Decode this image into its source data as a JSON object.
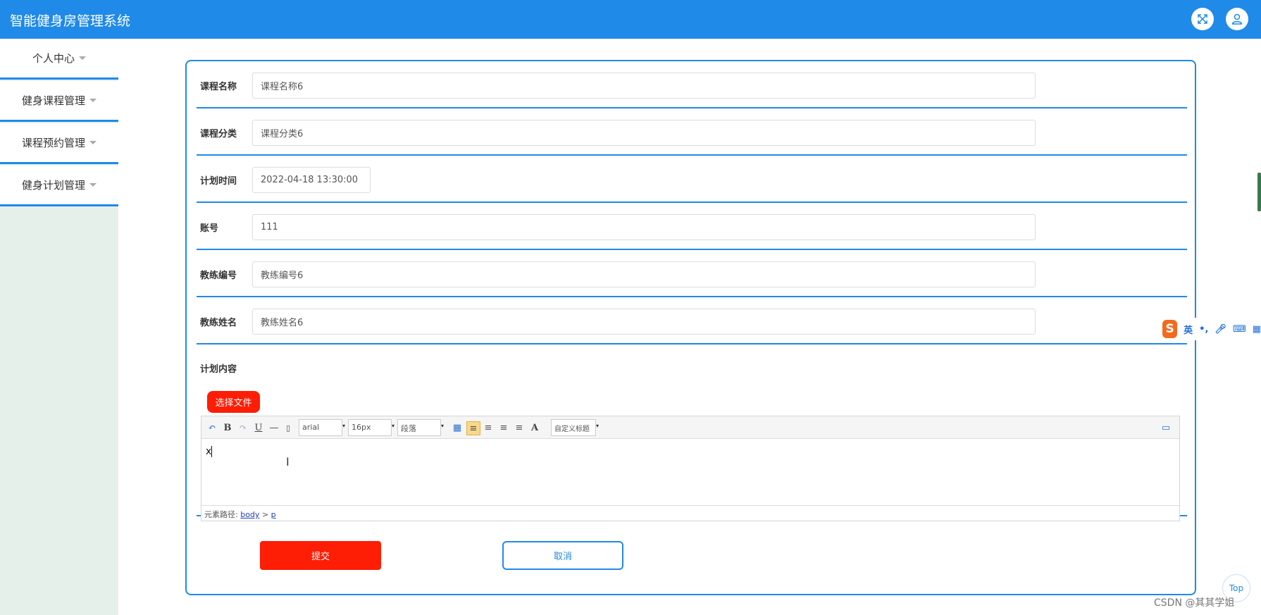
{
  "header": {
    "title": "智能健身房管理系统",
    "fullscreen_icon": "fullscreen-icon",
    "user_icon": "user-icon"
  },
  "sidebar": {
    "items": [
      {
        "label": "个人中心"
      },
      {
        "label": "健身课程管理"
      },
      {
        "label": "课程预约管理"
      },
      {
        "label": "健身计划管理"
      }
    ]
  },
  "form": {
    "fields": [
      {
        "label": "课程名称",
        "value": "课程名称6"
      },
      {
        "label": "课程分类",
        "value": "课程分类6"
      },
      {
        "label": "计划时间",
        "value": "2022-04-18 13:30:00"
      },
      {
        "label": "账号",
        "value": "111"
      },
      {
        "label": "教练编号",
        "value": "教练编号6"
      },
      {
        "label": "教练姓名",
        "value": "教练姓名6"
      }
    ],
    "content_label": "计划内容",
    "choose_file": "选择文件",
    "editor": {
      "font_family": "arial",
      "font_size": "16px",
      "paragraph": "段落",
      "custom_heading": "自定义标题",
      "text": "x",
      "path_label": "元素路径:",
      "path_body": "body",
      "path_sep": ">",
      "path_p": "p"
    },
    "submit": "提交",
    "cancel": "取消"
  },
  "ime": {
    "logo": "S",
    "lang": "英",
    "punct": "•,"
  },
  "top_button": "Top",
  "watermark": "CSDN @其其学姐",
  "colors": {
    "primary": "#1f8ae8",
    "danger": "#fe1d05",
    "sidebar_bg": "#e5f0eb"
  }
}
